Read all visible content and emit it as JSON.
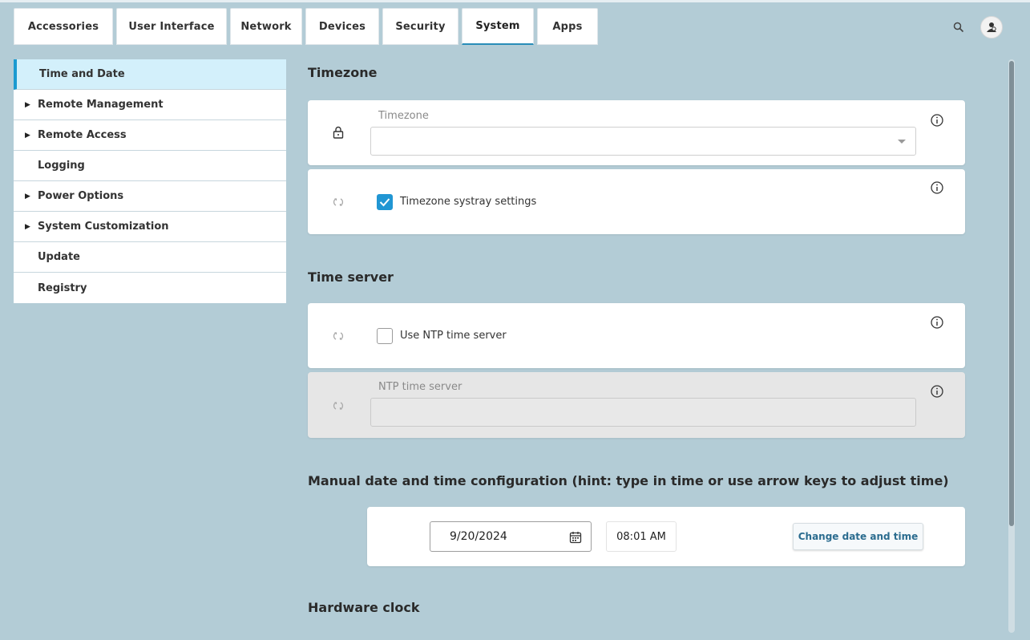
{
  "tabs": [
    "Accessories",
    "User Interface",
    "Network",
    "Devices",
    "Security",
    "System",
    "Apps"
  ],
  "active_tab": "System",
  "sidebar": {
    "items": [
      {
        "label": "Time and Date",
        "expandable": false,
        "selected": true
      },
      {
        "label": "Remote Management",
        "expandable": true,
        "selected": false
      },
      {
        "label": "Remote Access",
        "expandable": true,
        "selected": false
      },
      {
        "label": "Logging",
        "expandable": false,
        "selected": false
      },
      {
        "label": "Power Options",
        "expandable": true,
        "selected": false
      },
      {
        "label": "System Customization",
        "expandable": true,
        "selected": false
      },
      {
        "label": "Update",
        "expandable": false,
        "selected": false
      },
      {
        "label": "Registry",
        "expandable": false,
        "selected": false
      }
    ]
  },
  "sections": {
    "timezone": {
      "title": "Timezone",
      "field_label": "Timezone",
      "field_value": "",
      "systray_label": "Timezone systray settings",
      "systray_checked": true
    },
    "time_server": {
      "title": "Time server",
      "ntp_checkbox_label": "Use NTP time server",
      "ntp_checked": false,
      "ntp_field_label": "NTP time server",
      "ntp_field_value": ""
    },
    "manual": {
      "title": "Manual date and time configuration (hint: type in time or use arrow keys to adjust time)",
      "date": "9/20/2024",
      "time": "08:01 AM",
      "button_label": "Change date and time"
    },
    "hardware_clock": {
      "title": "Hardware clock"
    }
  },
  "icons": {
    "search": "search-icon",
    "user": "user-icon",
    "lock": "lock-icon",
    "sync": "sync-icon",
    "info": "info-icon",
    "calendar": "calendar-icon"
  },
  "colors": {
    "background": "#b3ccd6",
    "accent": "#1b9ad0",
    "selected_bg": "#d3f0fb",
    "checkbox": "#2196d3",
    "button_text": "#2b6c8f"
  }
}
